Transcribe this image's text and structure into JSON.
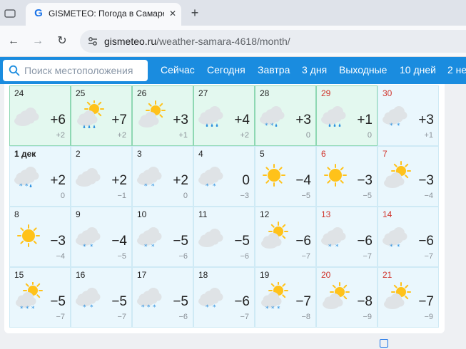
{
  "browser": {
    "tab_title": "GISMETEO: Погода в Самаре н",
    "favicon_letter": "G",
    "close_glyph": "✕",
    "new_tab_glyph": "+",
    "back_glyph": "←",
    "forward_glyph": "→",
    "reload_glyph": "↻",
    "url_host": "gismeteo.ru",
    "url_path": "/weather-samara-4618/month/"
  },
  "site": {
    "search_placeholder": "Поиск местоположения",
    "nav": [
      "Сейчас",
      "Сегодня",
      "Завтра",
      "3 дня",
      "Выходные",
      "10 дней",
      "2 не"
    ]
  },
  "calendar": {
    "rows": [
      [
        {
          "day": "24",
          "max": "+6",
          "min": "+2",
          "wx": "cloudy",
          "hl": true
        },
        {
          "day": "25",
          "max": "+7",
          "min": "+2",
          "wx": "sun-rain",
          "hl": true
        },
        {
          "day": "26",
          "max": "+3",
          "min": "+1",
          "wx": "sun-cloud",
          "hl": true
        },
        {
          "day": "27",
          "max": "+4",
          "min": "+2",
          "wx": "rain",
          "hl": true
        },
        {
          "day": "28",
          "max": "+3",
          "min": "0",
          "wx": "snow-rain",
          "hl": true
        },
        {
          "day": "29",
          "max": "+1",
          "min": "0",
          "wx": "rain",
          "hl": true,
          "we": true
        },
        {
          "day": "30",
          "max": "+3",
          "min": "+1",
          "wx": "snow",
          "we": true
        }
      ],
      [
        {
          "day": "1 дек",
          "max": "+2",
          "min": "0",
          "wx": "snow-rain",
          "bold": true
        },
        {
          "day": "2",
          "max": "+2",
          "min": "−1",
          "wx": "cloudy"
        },
        {
          "day": "3",
          "max": "+2",
          "min": "0",
          "wx": "snow"
        },
        {
          "day": "4",
          "max": "0",
          "min": "−3",
          "wx": "snow"
        },
        {
          "day": "5",
          "max": "−4",
          "min": "−5",
          "wx": "sun"
        },
        {
          "day": "6",
          "max": "−3",
          "min": "−5",
          "wx": "sun",
          "we": true
        },
        {
          "day": "7",
          "max": "−3",
          "min": "−4",
          "wx": "sun-cloud",
          "we": true
        }
      ],
      [
        {
          "day": "8",
          "max": "−3",
          "min": "−4",
          "wx": "sun"
        },
        {
          "day": "9",
          "max": "−4",
          "min": "−5",
          "wx": "snow"
        },
        {
          "day": "10",
          "max": "−5",
          "min": "−6",
          "wx": "snow"
        },
        {
          "day": "11",
          "max": "−5",
          "min": "−6",
          "wx": "cloudy"
        },
        {
          "day": "12",
          "max": "−6",
          "min": "−7",
          "wx": "sun-cloud"
        },
        {
          "day": "13",
          "max": "−6",
          "min": "−7",
          "wx": "snow",
          "we": true
        },
        {
          "day": "14",
          "max": "−6",
          "min": "−7",
          "wx": "snow",
          "we": true
        }
      ],
      [
        {
          "day": "15",
          "max": "−5",
          "min": "−7",
          "wx": "sun-snow"
        },
        {
          "day": "16",
          "max": "−5",
          "min": "−7",
          "wx": "snow"
        },
        {
          "day": "17",
          "max": "−5",
          "min": "−6",
          "wx": "snow3"
        },
        {
          "day": "18",
          "max": "−6",
          "min": "−7",
          "wx": "snow"
        },
        {
          "day": "19",
          "max": "−7",
          "min": "−8",
          "wx": "sun-snow"
        },
        {
          "day": "20",
          "max": "−8",
          "min": "−9",
          "wx": "sun-cloud",
          "we": true
        },
        {
          "day": "21",
          "max": "−7",
          "min": "−9",
          "wx": "sun-cloud",
          "we": true
        }
      ]
    ]
  },
  "colors": {
    "header_blue": "#1a8cdf",
    "cell_bg": "#eaf7fd",
    "highlight_bg": "#e3f8ef",
    "weekend_red": "#d0342c"
  }
}
